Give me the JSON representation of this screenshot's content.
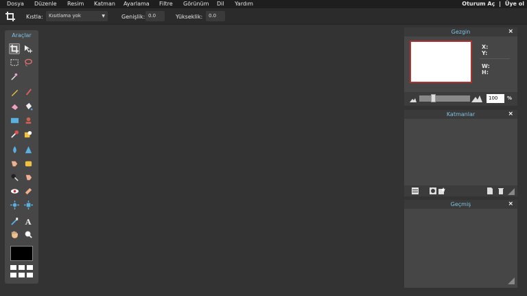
{
  "menu": {
    "items": [
      "Dosya",
      "Düzenle",
      "Resim",
      "Katman",
      "Ayarlama",
      "Filtre",
      "Görünüm",
      "Dil",
      "Yardım"
    ],
    "login": "Oturum Aç",
    "separator": "|",
    "signup": "Üye ol"
  },
  "options": {
    "constrain_label": "Kıstla:",
    "constrain_value": "Kısıtlama yok",
    "width_label": "Genişlik:",
    "width_value": "0.0",
    "height_label": "Yükseklik:",
    "height_value": "0.0"
  },
  "tools": {
    "title": "Araçlar",
    "items": [
      "crop-icon",
      "move-icon",
      "marquee-select-icon",
      "lasso-icon",
      "magic-wand-icon",
      "pencil-icon",
      "brush-icon",
      "eraser-icon",
      "paint-bucket-icon",
      "gradient-icon",
      "clone-stamp-icon",
      "color-replace-icon",
      "drawing-icon",
      "blur-icon",
      "sharpen-icon",
      "smudge-icon",
      "sponge-icon",
      "dodge-icon",
      "burn-icon",
      "red-eye-icon",
      "spot-heal-icon",
      "bloat-icon",
      "pinch-icon",
      "color-picker-icon",
      "type-icon",
      "hand-icon",
      "zoom-icon"
    ],
    "color_main": "#000000"
  },
  "navigator": {
    "title": "Gezgin",
    "close": "×",
    "x_label": "X:",
    "y_label": "Y:",
    "w_label": "W:",
    "h_label": "H:",
    "zoom_value": "100",
    "zoom_unit": "%"
  },
  "layers": {
    "title": "Katmanlar",
    "close": "×"
  },
  "history": {
    "title": "Geçmiş",
    "close": "×"
  },
  "colors": {
    "accent": "#7ec3e5",
    "background": "#333333",
    "panel": "#464646"
  }
}
